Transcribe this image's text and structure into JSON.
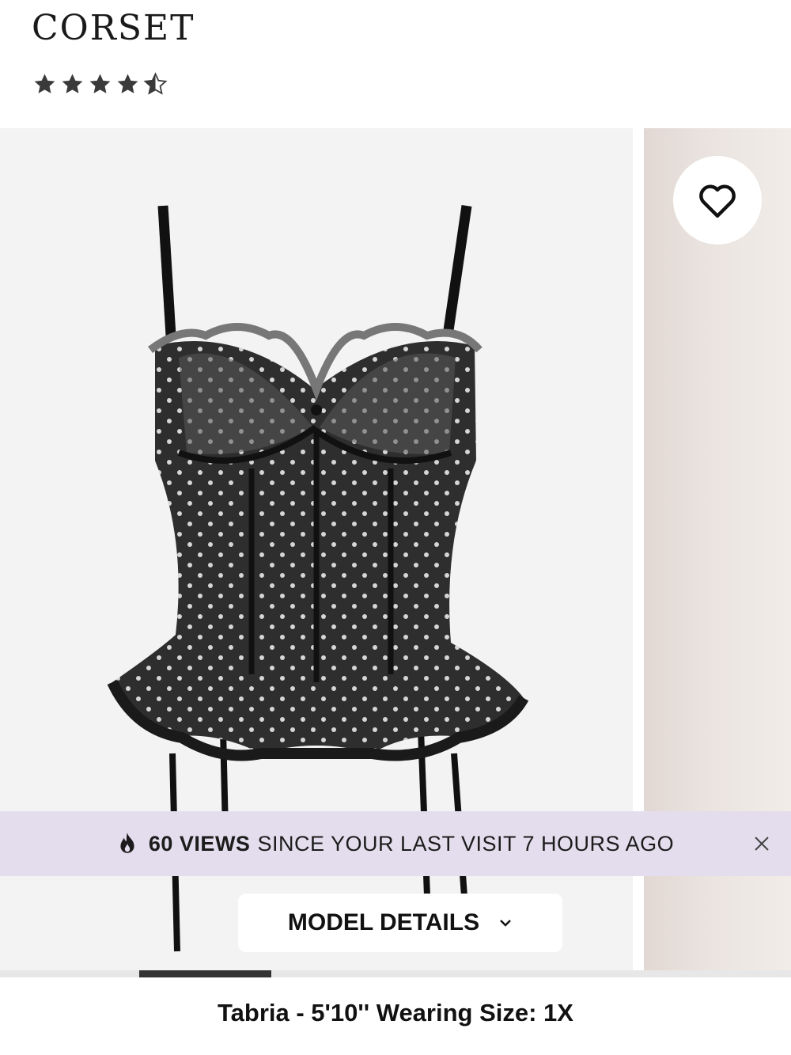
{
  "product": {
    "title": "CORSET",
    "rating": 4.5,
    "rating_max": 5
  },
  "gallery": {
    "image_alt_icon": "corset-product-image",
    "favorite_icon": "heart-outline-icon",
    "progress": 0.167
  },
  "banner": {
    "icon": "flame-icon",
    "views": "60 VIEWS",
    "message": "SINCE YOUR LAST VISIT 7 HOURS AGO",
    "close_icon": "close-icon"
  },
  "model_details": {
    "button_label": "MODEL DETAILS",
    "chevron_icon": "chevron-down-icon",
    "info": "Tabria - 5'10'' Wearing Size: 1X"
  },
  "colors": {
    "banner_bg": "#e3dded",
    "photo_bg": "#f3f3f3",
    "text": "#111111"
  }
}
